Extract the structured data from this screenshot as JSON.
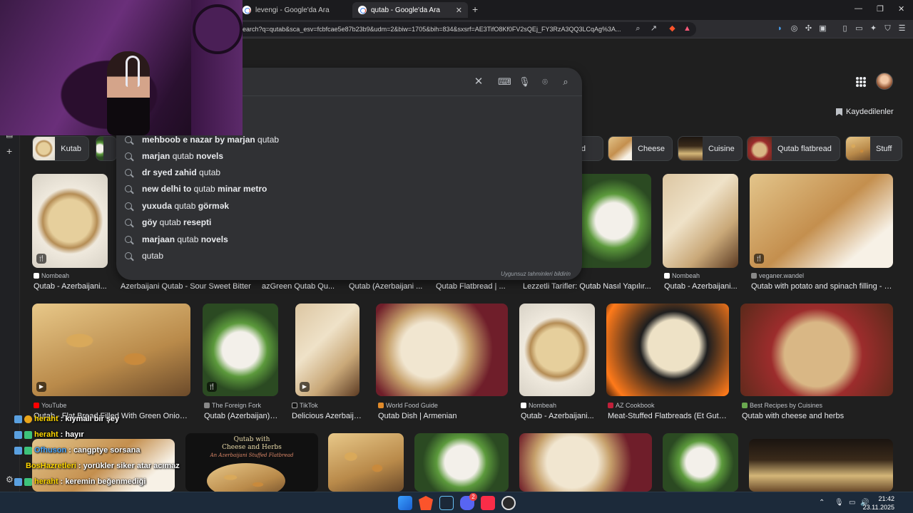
{
  "browser": {
    "tabs": [
      {
        "title": "levengi - Google'da Ara"
      },
      {
        "title": "qutab - Google'da Ara"
      }
    ],
    "address": "earch?q=qutab&sca_esv=fcbfcae5e87b23b9&udm=2&biw=1705&bih=834&sxsrf=AE3TifO8Kf0FV2sQEj_FY3RzA3QQ3LCqAg%3A..."
  },
  "header": {
    "saved_label": "Kaydedilenler"
  },
  "chips": [
    {
      "label": "Kutab"
    },
    {
      "label": "read"
    },
    {
      "label": "Cheese"
    },
    {
      "label": "Cuisine"
    },
    {
      "label": "Qutab flatbread"
    },
    {
      "label": "Stuff"
    }
  ],
  "suggestions": [
    {
      "bold_pre": "mehboob e nazar by marjan ",
      "plain": "qutab",
      "bold_post": ""
    },
    {
      "bold_pre": "marjan ",
      "plain": "qutab",
      "bold_post": " novels"
    },
    {
      "bold_pre": "dr syed zahid ",
      "plain": "qutab",
      "bold_post": ""
    },
    {
      "bold_pre": "new delhi to ",
      "plain": "qutab",
      "bold_post": " minar metro"
    },
    {
      "bold_pre": "yuxuda ",
      "plain": "qutab",
      "bold_post": " görmək"
    },
    {
      "bold_pre": "göy ",
      "plain": "qutab",
      "bold_post": " resepti"
    },
    {
      "bold_pre": "marjaan ",
      "plain": "qutab",
      "bold_post": " novels"
    },
    {
      "bold_pre": "",
      "plain": "qutab",
      "bold_post": ""
    }
  ],
  "suggest_report": "Uygunsuz tahminleri bildirin",
  "row1": [
    {
      "source": "Nombeah",
      "title": "Qutab - Azerbaijani..."
    },
    {
      "source": "",
      "title": "Azerbaijani Qutab - Sour Sweet Bitter"
    },
    {
      "source": "",
      "title": "azGreen Qutab Qu..."
    },
    {
      "source": "",
      "title": "Qutab (Azerbaijani ..."
    },
    {
      "source": "",
      "title": "Qutab Flatbread | ..."
    },
    {
      "source": "",
      "title": "Lezzetli Tarifler: Qutab Nasıl Yapılır..."
    },
    {
      "source": "Nombeah",
      "title": "Qutab - Azerbaijani..."
    },
    {
      "source": "veganer.wandel",
      "title": "Qutab with potato and spinach filling - v..."
    }
  ],
  "row2": [
    {
      "source": "YouTube",
      "title": "Qutab - Flat Bread Filled With Green Onion ..."
    },
    {
      "source": "The Foreign Fork",
      "title": "Qutab (Azerbaijan):..."
    },
    {
      "source": "TikTok",
      "title": "Delicious Azerbaija..."
    },
    {
      "source": "World Food Guide",
      "title": "Qutab Dish | Armenian"
    },
    {
      "source": "Nombeah",
      "title": "Qutab - Azerbaijani..."
    },
    {
      "source": "AZ Cookbook",
      "title": "Meat-Stuffed Flatbreads (Et Guta..."
    },
    {
      "source": "Best Recipes by Cuisines",
      "title": "Qutab with cheese and herbs"
    }
  ],
  "row3_overlay_text": {
    "line1": "Qutab with",
    "line2": "Cheese and Herbs",
    "line3": "An Azerbaijani Stuffed Flatbread"
  },
  "chat": [
    {
      "user": "heraht",
      "msg": ": kıymalı bir şey",
      "color": "#ffd700"
    },
    {
      "user": "heraht",
      "msg": ": hayır",
      "color": "#ffd700"
    },
    {
      "user": "Ofhuson",
      "msg": ": cangptye sorsana",
      "color": "#4aa8ff"
    },
    {
      "user": "BosHazretleri",
      "msg": ": yorükler siker atar acımaz",
      "color": "#ffd700"
    },
    {
      "user": "heraht",
      "msg": ": keremin beğenmediği",
      "color": "#ffd700"
    }
  ],
  "taskbar": {
    "time": "21:42",
    "date": "23.11.2025",
    "discord_badge": "2"
  }
}
